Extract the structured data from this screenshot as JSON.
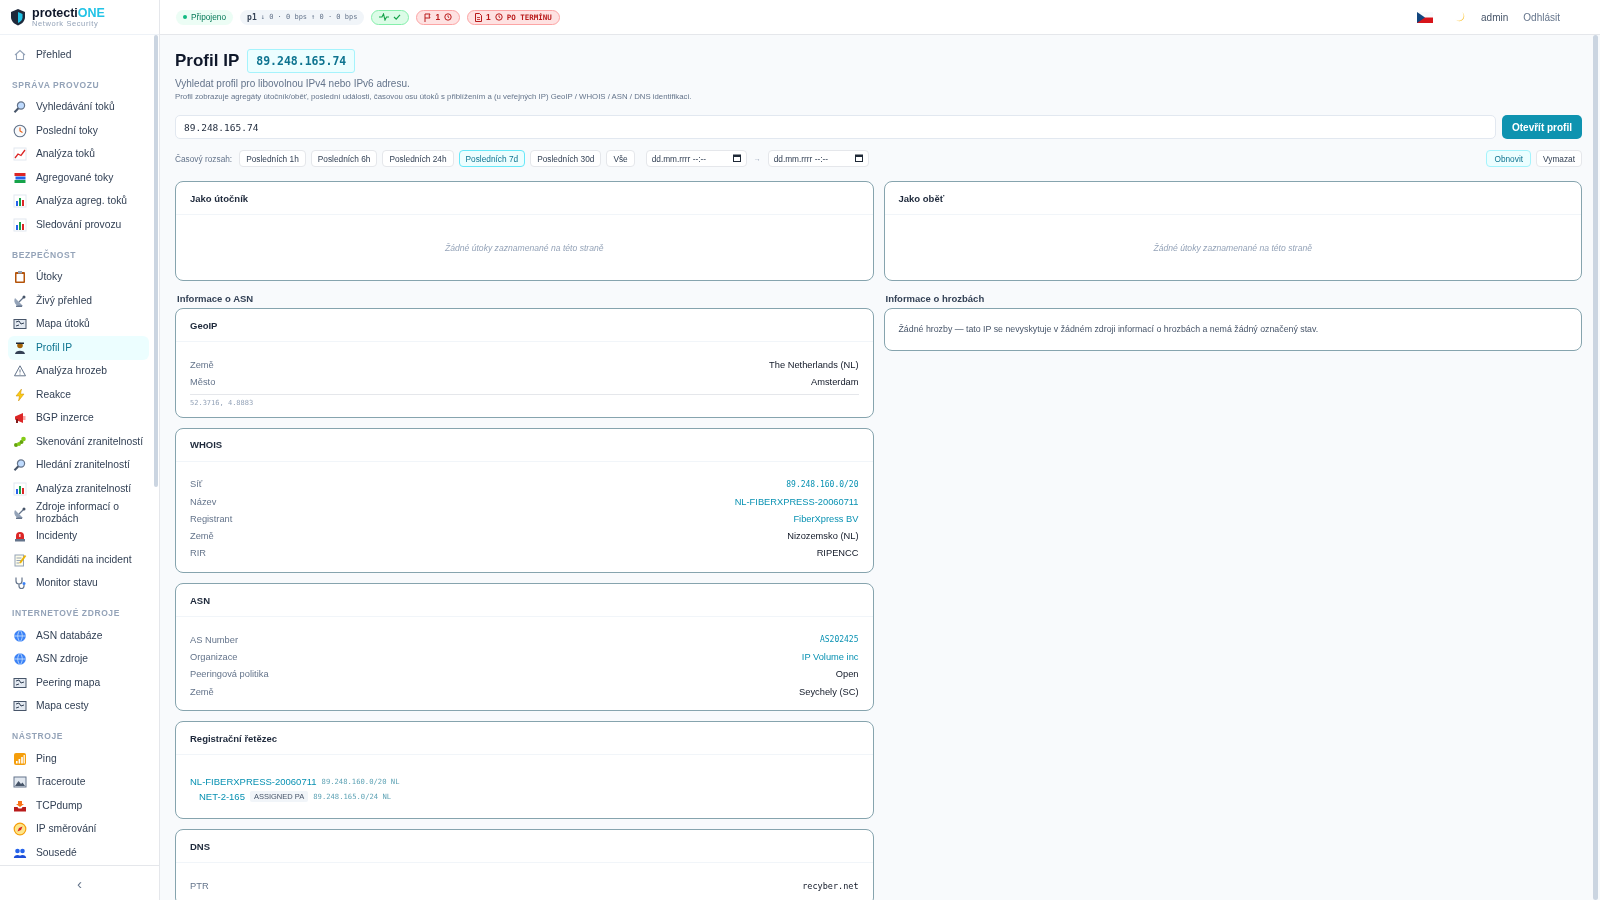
{
  "brand": {
    "name": "protecti",
    "accent": "ONE",
    "tagline": "Network Security"
  },
  "sidebar": {
    "top_items": [
      {
        "label": "Přehled",
        "selected": false
      }
    ],
    "sections": [
      {
        "title": "SPRÁVA PROVOZU",
        "items": [
          {
            "label": "Vyhledávání toků",
            "selected": false
          },
          {
            "label": "Poslední toky",
            "selected": false
          },
          {
            "label": "Analýza toků",
            "selected": false
          },
          {
            "label": "Agregované toky",
            "selected": false
          },
          {
            "label": "Analýza agreg. toků",
            "selected": false
          },
          {
            "label": "Sledování provozu",
            "selected": false
          }
        ]
      },
      {
        "title": "BEZPEČNOST",
        "items": [
          {
            "label": "Útoky",
            "selected": false
          },
          {
            "label": "Živý přehled",
            "selected": false
          },
          {
            "label": "Mapa útoků",
            "selected": false
          },
          {
            "label": "Profil IP",
            "selected": true
          },
          {
            "label": "Analýza hrozeb",
            "selected": false
          },
          {
            "label": "Reakce",
            "selected": false
          },
          {
            "label": "BGP inzerce",
            "selected": false
          },
          {
            "label": "Skenování zranitelností",
            "selected": false
          },
          {
            "label": "Hledání zranitelností",
            "selected": false
          },
          {
            "label": "Analýza zranitelností",
            "selected": false
          },
          {
            "label": "Zdroje informací o hrozbách",
            "selected": false
          },
          {
            "label": "Incidenty",
            "selected": false
          },
          {
            "label": "Kandidáti na incident",
            "selected": false
          },
          {
            "label": "Monitor stavu",
            "selected": false
          }
        ]
      },
      {
        "title": "INTERNETOVÉ ZDROJE",
        "items": [
          {
            "label": "ASN databáze",
            "selected": false
          },
          {
            "label": "ASN zdroje",
            "selected": false
          },
          {
            "label": "Peering mapa",
            "selected": false
          },
          {
            "label": "Mapa cesty",
            "selected": false
          }
        ]
      },
      {
        "title": "NÁSTROJE",
        "items": [
          {
            "label": "Ping",
            "selected": false
          },
          {
            "label": "Traceroute",
            "selected": false
          },
          {
            "label": "TCPdump",
            "selected": false
          },
          {
            "label": "IP směrování",
            "selected": false
          },
          {
            "label": "Sousedé",
            "selected": false
          }
        ]
      }
    ],
    "collapse": "‹"
  },
  "topbar": {
    "status": {
      "label": "Připojeno",
      "connected": true
    },
    "traffic": {
      "interface": "p1",
      "down": "↓ 0 · 0 bps",
      "up": "↑ 0 · 0 bps"
    },
    "health": {
      "ok": true
    },
    "alerts": {
      "count": "1"
    },
    "overdue": {
      "count": "1",
      "label": "PO TERMÍNU"
    },
    "user": "admin",
    "logout": "Odhlásit"
  },
  "main": {
    "title": "Profil IP",
    "ip_badge": "89.248.165.74",
    "subtitle": "Vyhledat profil pro libovolnou IPv4 nebo IPv6 adresu.",
    "description": "Profil zobrazuje agregáty útočník/oběť, poslední události, časovou osu útoků s přiblížením a (u veřejných IP) GeoIP / WHOIS / ASN / DNS identifikaci.",
    "search": {
      "value": "89.248.165.74",
      "button": "Otevřít profil"
    },
    "time_range": {
      "label": "Časový rozsah:",
      "presets": [
        {
          "label": "Posledních 1h",
          "selected": false
        },
        {
          "label": "Posledních 6h",
          "selected": false
        },
        {
          "label": "Posledních 24h",
          "selected": false
        },
        {
          "label": "Posledních 7d",
          "selected": true
        },
        {
          "label": "Posledních 30d",
          "selected": false
        },
        {
          "label": "Vše",
          "selected": false
        }
      ],
      "from": {
        "placeholder": "dd.mm.rrrr --:--"
      },
      "separator": "→",
      "to": {
        "placeholder": "dd.mm.rrrr --:--"
      },
      "refresh": "Obnovit",
      "clear": "Vymazat"
    },
    "attacker": {
      "title": "Jako útočník",
      "empty": "Žádné útoky zaznamenané na této straně"
    },
    "victim": {
      "title": "Jako oběť",
      "empty": "Žádné útoky zaznamenané na této straně"
    },
    "asn_info": {
      "heading": "Informace o ASN",
      "cards": [
        {
          "kind": "fields",
          "title": "GeoIP",
          "rows": [
            {
              "label": "Země",
              "value": "The Netherlands (NL)",
              "kind": "text"
            },
            {
              "label": "Město",
              "value": "Amsterdam",
              "kind": "text"
            }
          ],
          "note": "52.3716, 4.8883"
        },
        {
          "kind": "fields",
          "title": "WHOIS",
          "rows": [
            {
              "label": "Síť",
              "value": "89.248.160.0/20",
              "kind": "mono-link"
            },
            {
              "label": "Název",
              "value": "NL-FIBERXPRESS-20060711",
              "kind": "link"
            },
            {
              "label": "Registrant",
              "value": "FiberXpress BV",
              "kind": "link"
            },
            {
              "label": "Země",
              "value": "Nizozemsko (NL)",
              "kind": "text"
            },
            {
              "label": "RIR",
              "value": "RIPENCC",
              "kind": "text"
            }
          ]
        },
        {
          "kind": "fields",
          "title": "ASN",
          "rows": [
            {
              "label": "AS Number",
              "value": "AS202425",
              "kind": "mono-link"
            },
            {
              "label": "Organizace",
              "value": "IP Volume inc",
              "kind": "link"
            },
            {
              "label": "Peeringová politika",
              "value": "Open",
              "kind": "text"
            },
            {
              "label": "Země",
              "value": "Seychely (SC)",
              "kind": "text"
            }
          ]
        },
        {
          "kind": "chain",
          "title": "Registrační řetězec",
          "entries": [
            {
              "name": "NL-FIBERXPRESS-20060711",
              "range": "89.248.160.0/20 NL",
              "children": [
                {
                  "name": "NET-2-165",
                  "tag": "ASSIGNED PA",
                  "range": "89.248.165.0/24 NL"
                }
              ]
            }
          ]
        },
        {
          "kind": "fields",
          "title": "DNS",
          "rows": [
            {
              "label": "PTR",
              "value": "recyber.net",
              "kind": "mono"
            }
          ]
        }
      ]
    },
    "threat_info": {
      "heading": "Informace o hrozbách",
      "text": "Žádné hrozby — tato IP se nevyskytuje v žádném zdroji informací o hrozbách a nemá žádný označený stav."
    }
  }
}
